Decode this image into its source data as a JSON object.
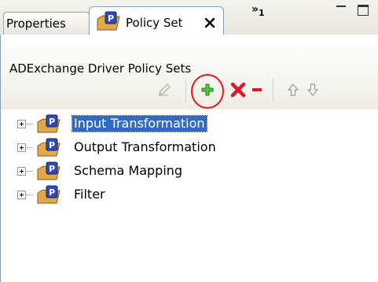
{
  "tabs": {
    "properties_label": "Properties",
    "policy_set_label": "Policy Set",
    "overflow_label": "»",
    "overflow_count": "1"
  },
  "panel": {
    "title": "ADExchange Driver Policy Sets"
  },
  "toolbar": {
    "edit_icon": "pencil-icon",
    "add_icon": "plus-icon",
    "delete_icon": "red-x-icon",
    "remove_icon": "minus-icon",
    "up_icon": "arrow-up-icon",
    "down_icon": "arrow-down-icon"
  },
  "tree": {
    "items": [
      {
        "label": "Input Transformation",
        "selected": true
      },
      {
        "label": "Output Transformation",
        "selected": false
      },
      {
        "label": "Schema Mapping",
        "selected": false
      },
      {
        "label": "Filter",
        "selected": false
      }
    ]
  },
  "colors": {
    "selection": "#316ac5",
    "add_green": "#3aa32c",
    "delete_red": "#e0182a",
    "highlight_ring": "#e8161c"
  }
}
